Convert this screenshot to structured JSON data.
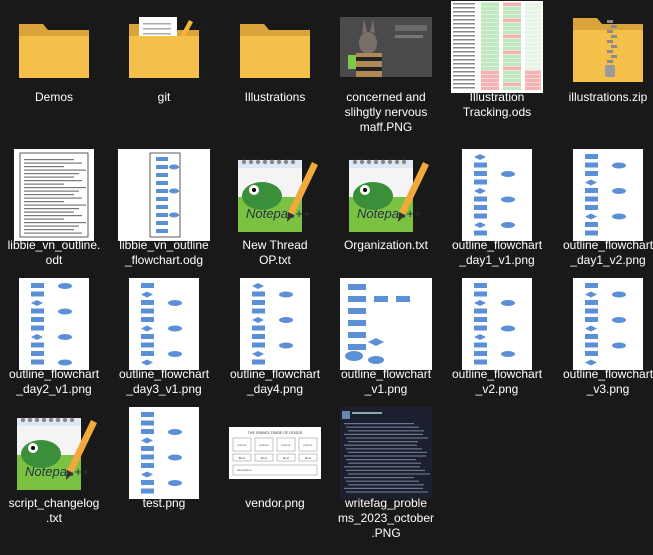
{
  "items": [
    {
      "label": "Demos",
      "kind": "folder"
    },
    {
      "label": "git",
      "kind": "folder-docs"
    },
    {
      "label": "Illustrations",
      "kind": "folder"
    },
    {
      "label": "concerned and\nslihgtly nervous\nmaff.PNG",
      "kind": "image-char"
    },
    {
      "label": "Illustration\nTracking.ods",
      "kind": "spreadsheet"
    },
    {
      "label": "illustrations.zip",
      "kind": "zip"
    },
    {
      "label": "libbie_vn_outline.\nodt",
      "kind": "document"
    },
    {
      "label": "libbie_vn_outline\n_flowchart.odg",
      "kind": "flowchart-doc"
    },
    {
      "label": "New Thread\nOP.txt",
      "kind": "notepad"
    },
    {
      "label": "Organization.txt",
      "kind": "notepad"
    },
    {
      "label": "outline_flowchart\n_day1_v1.png",
      "kind": "flowchart"
    },
    {
      "label": "outline_flowchart\n_day1_v2.png",
      "kind": "flowchart"
    },
    {
      "label": "outline_flowchart\n_day2_v1.png",
      "kind": "flowchart"
    },
    {
      "label": "outline_flowchart\n_day3_v1.png",
      "kind": "flowchart"
    },
    {
      "label": "outline_flowchart\n_day4.png",
      "kind": "flowchart"
    },
    {
      "label": "outline_flowchart\n_v1.png",
      "kind": "flowchart-wide"
    },
    {
      "label": "outline_flowchart\n_v2.png",
      "kind": "flowchart"
    },
    {
      "label": "outline_flowchart\n_v3.png",
      "kind": "flowchart"
    },
    {
      "label": "script_changelog\n.txt",
      "kind": "notepad"
    },
    {
      "label": "test.png",
      "kind": "flowchart"
    },
    {
      "label": "vendor.png",
      "kind": "vendor"
    },
    {
      "label": "writefag_proble\nms_2023_october\n.PNG",
      "kind": "dark-screenshot"
    }
  ],
  "vendor_thumb": {
    "title": "THE GRAVEL TRADE OF GOODS",
    "cells": [
      "picture",
      "picture",
      "picture",
      "picture",
      "$lost",
      "$lost",
      "$lost",
      "$lost"
    ],
    "footer": "description"
  },
  "colors": {
    "background": "#191919",
    "folder": "#f5c04a",
    "flow_shape": "#5b8fd6"
  }
}
